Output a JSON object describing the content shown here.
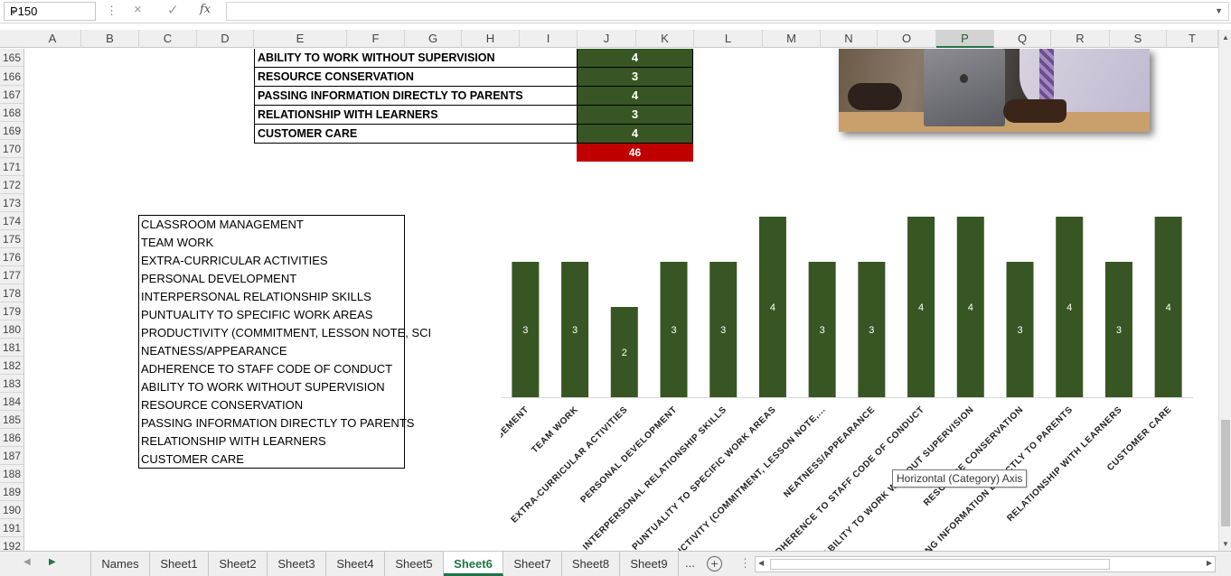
{
  "formula_bar": {
    "name_box": "P150",
    "cancel_icon": "×",
    "enter_icon": "✓",
    "fx_label": "fx",
    "formula_value": ""
  },
  "columns": [
    "A",
    "B",
    "C",
    "D",
    "E",
    "F",
    "G",
    "H",
    "I",
    "J",
    "K",
    "L",
    "M",
    "N",
    "O",
    "P",
    "Q",
    "R",
    "S",
    "T"
  ],
  "selected_column": "P",
  "rows": [
    "165",
    "166",
    "167",
    "168",
    "169",
    "170",
    "171",
    "172",
    "173",
    "174",
    "175",
    "176",
    "177",
    "178",
    "179",
    "180",
    "181",
    "182",
    "183",
    "184",
    "185",
    "186",
    "187",
    "188",
    "189",
    "190",
    "191",
    "192"
  ],
  "score_table": {
    "rows": [
      {
        "label": "ABILITY TO WORK WITHOUT SUPERVISION",
        "score": "4"
      },
      {
        "label": "RESOURCE CONSERVATION",
        "score": "3"
      },
      {
        "label": "PASSING INFORMATION DIRECTLY TO PARENTS",
        "score": "4"
      },
      {
        "label": "RELATIONSHIP WITH LEARNERS",
        "score": "3"
      },
      {
        "label": "CUSTOMER CARE",
        "score": "4"
      }
    ],
    "total": "46",
    "score_color": "#375623",
    "total_color": "#C00000"
  },
  "criteria_list": [
    "CLASSROOM MANAGEMENT",
    "TEAM WORK",
    "EXTRA-CURRICULAR ACTIVITIES",
    "PERSONAL DEVELOPMENT",
    "INTERPERSONAL RELATIONSHIP SKILLS",
    "PUNTUALITY TO SPECIFIC WORK AREAS",
    "PRODUCTIVITY (COMMITMENT, LESSON NOTE, SCI",
    "NEATNESS/APPEARANCE",
    "ADHERENCE TO STAFF CODE OF CONDUCT",
    "ABILITY TO WORK WITHOUT SUPERVISION",
    "RESOURCE CONSERVATION",
    "PASSING INFORMATION DIRECTLY TO PARENTS",
    "RELATIONSHIP WITH LEARNERS",
    "CUSTOMER CARE"
  ],
  "chart_data": {
    "type": "bar",
    "categories": [
      "CLASSROOM MANAGEMENT",
      "TEAM WORK",
      "EXTRA-CURRICULAR ACTIVITIES",
      "PERSONAL DEVELOPMENT",
      "INTERPERSONAL RELATIONSHIP SKILLS",
      "PUNTUALITY TO SPECIFIC WORK AREAS",
      "PRODUCTIVITY (COMMITMENT, LESSON NOTE,...",
      "NEATNESS/APPEARANCE",
      "ADHERENCE TO STAFF CODE OF CONDUCT",
      "ABILITY TO WORK WITHOUT SUPERVISION",
      "RESOURCE CONSERVATION",
      "PASSING INFORMATION DIRECTLY TO PARENTS",
      "RELATIONSHIP WITH LEARNERS",
      "CUSTOMER CARE"
    ],
    "values": [
      3,
      3,
      2,
      3,
      3,
      4,
      3,
      3,
      4,
      4,
      3,
      4,
      3,
      4
    ],
    "title": "",
    "xlabel": "",
    "ylabel": "",
    "ylim": [
      0,
      4
    ],
    "bar_color": "#375623",
    "data_labels": true,
    "grid": false
  },
  "tooltip": "Horizontal (Category) Axis",
  "sheet_tabs": [
    "Names",
    "Sheet1",
    "Sheet2",
    "Sheet3",
    "Sheet4",
    "Sheet5",
    "Sheet6",
    "Sheet7",
    "Sheet8",
    "Sheet9"
  ],
  "active_tab": "Sheet6",
  "more_tabs": "...",
  "add_sheet": "+"
}
